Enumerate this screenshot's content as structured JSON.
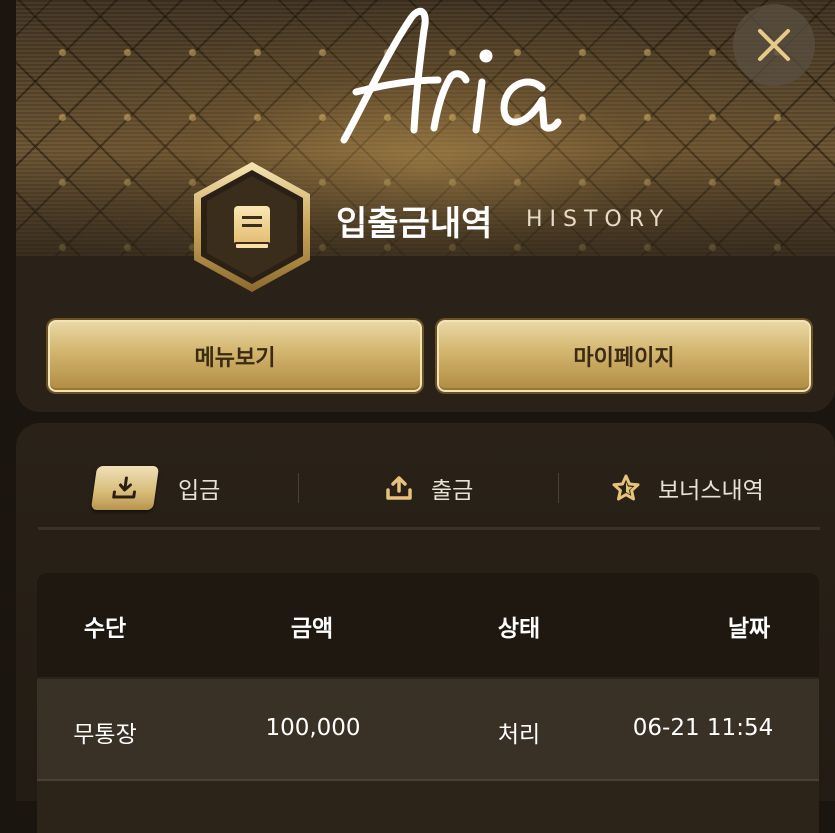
{
  "header": {
    "logo_text": "Aria",
    "close_icon": "close-icon",
    "section_icon": "book-icon",
    "title": "입출금내역",
    "subtitle": "HISTORY",
    "accent_gold": "#d2b46c"
  },
  "buttons": {
    "menu_label": "메뉴보기",
    "mypage_label": "마이페이지"
  },
  "tabs": [
    {
      "label": "입금",
      "icon": "download-icon",
      "active": true
    },
    {
      "label": "출금",
      "icon": "upload-icon",
      "active": false
    },
    {
      "label": "보너스내역",
      "icon": "star-icon",
      "active": false
    }
  ],
  "table": {
    "columns": [
      "수단",
      "금액",
      "상태",
      "날짜"
    ],
    "rows": [
      [
        "무통장",
        "100,000",
        "처리",
        "06-21 11:54"
      ]
    ]
  }
}
